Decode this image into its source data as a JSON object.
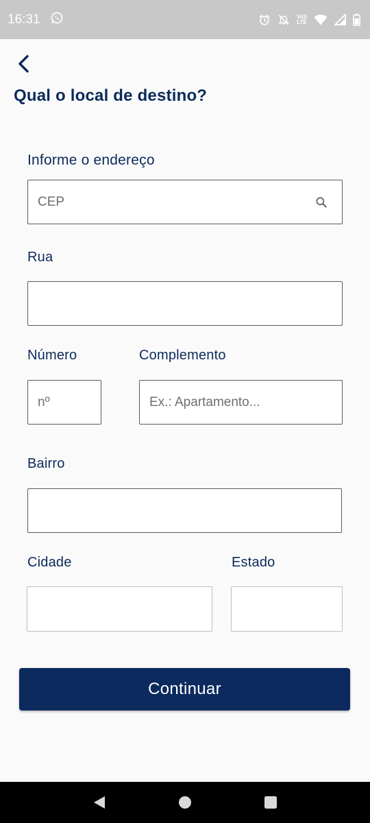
{
  "status_bar": {
    "time": "16:31",
    "volte_top": "Vo))",
    "volte_bottom": "LTE",
    "icons": [
      "whatsapp-icon",
      "alarm-icon",
      "mute-icon",
      "volte-icon",
      "wifi-icon",
      "signal-icon",
      "battery-icon"
    ]
  },
  "header": {
    "title": "Qual o local de destino?"
  },
  "form": {
    "address_label": "Informe o endereço",
    "cep_placeholder": "CEP",
    "rua_label": "Rua",
    "numero_label": "Número",
    "numero_placeholder": "nº",
    "complemento_label": "Complemento",
    "complemento_placeholder": "Ex.: Apartamento...",
    "bairro_label": "Bairro",
    "cidade_label": "Cidade",
    "estado_label": "Estado"
  },
  "actions": {
    "continue_label": "Continuar"
  },
  "colors": {
    "primary": "#0c2a5e",
    "label": "#0c2a5b",
    "status_bar": "#c8c8c8",
    "background": "#fafafa"
  }
}
